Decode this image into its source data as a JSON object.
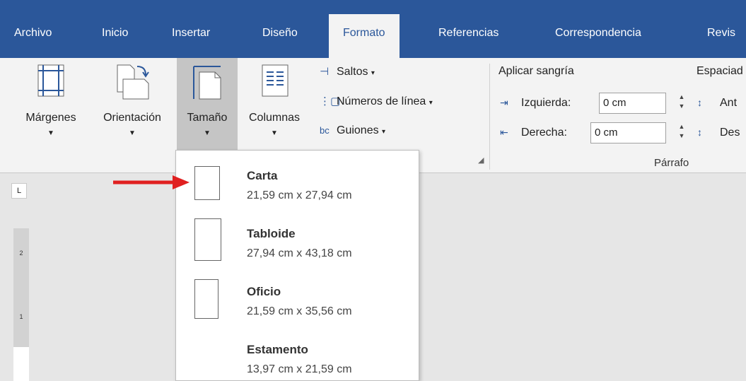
{
  "tabs": [
    {
      "label": "Archivo",
      "active": false
    },
    {
      "label": "Inicio",
      "active": false
    },
    {
      "label": "Insertar",
      "active": false
    },
    {
      "label": "Diseño",
      "active": false
    },
    {
      "label": "Formato",
      "active": true
    },
    {
      "label": "Referencias",
      "active": false
    },
    {
      "label": "Correspondencia",
      "active": false
    },
    {
      "label": "Revis",
      "active": false
    }
  ],
  "ribbon": {
    "page_setup": {
      "buttons": [
        {
          "label": "Márgenes",
          "icon": "margins-icon"
        },
        {
          "label": "Orientación",
          "icon": "orientation-icon"
        },
        {
          "label": "Tamaño",
          "icon": "size-icon",
          "selected": true
        },
        {
          "label": "Columnas",
          "icon": "columns-icon"
        }
      ],
      "small_commands": [
        {
          "label": "Saltos",
          "icon": "breaks-icon"
        },
        {
          "label": "Números de línea",
          "icon": "line-numbers-icon"
        },
        {
          "label": "Guiones",
          "icon": "hyphenation-icon"
        }
      ]
    },
    "paragraph": {
      "indent_heading": "Aplicar sangría",
      "left_label": "Izquierda:",
      "left_value": "0 cm",
      "right_label": "Derecha:",
      "right_value": "0 cm",
      "spacing_heading": "Espaciad",
      "before_label": "Ant",
      "after_label": "Des",
      "group_label": "Párrafo"
    }
  },
  "size_menu": {
    "options": [
      {
        "name": "Carta",
        "dims": "21,59 cm x 27,94 cm"
      },
      {
        "name": "Tabloide",
        "dims": "27,94 cm x 43,18 cm"
      },
      {
        "name": "Oficio",
        "dims": "21,59 cm x 35,56 cm"
      },
      {
        "name": "Estamento",
        "dims": "13,97 cm x 21,59 cm"
      }
    ]
  },
  "ruler": {
    "marks": [
      "2",
      "1"
    ],
    "corner": "L"
  },
  "colors": {
    "tab_blue": "#2b579a",
    "ribbon_bg": "#f3f3f3",
    "arrow_red": "#e02020"
  }
}
